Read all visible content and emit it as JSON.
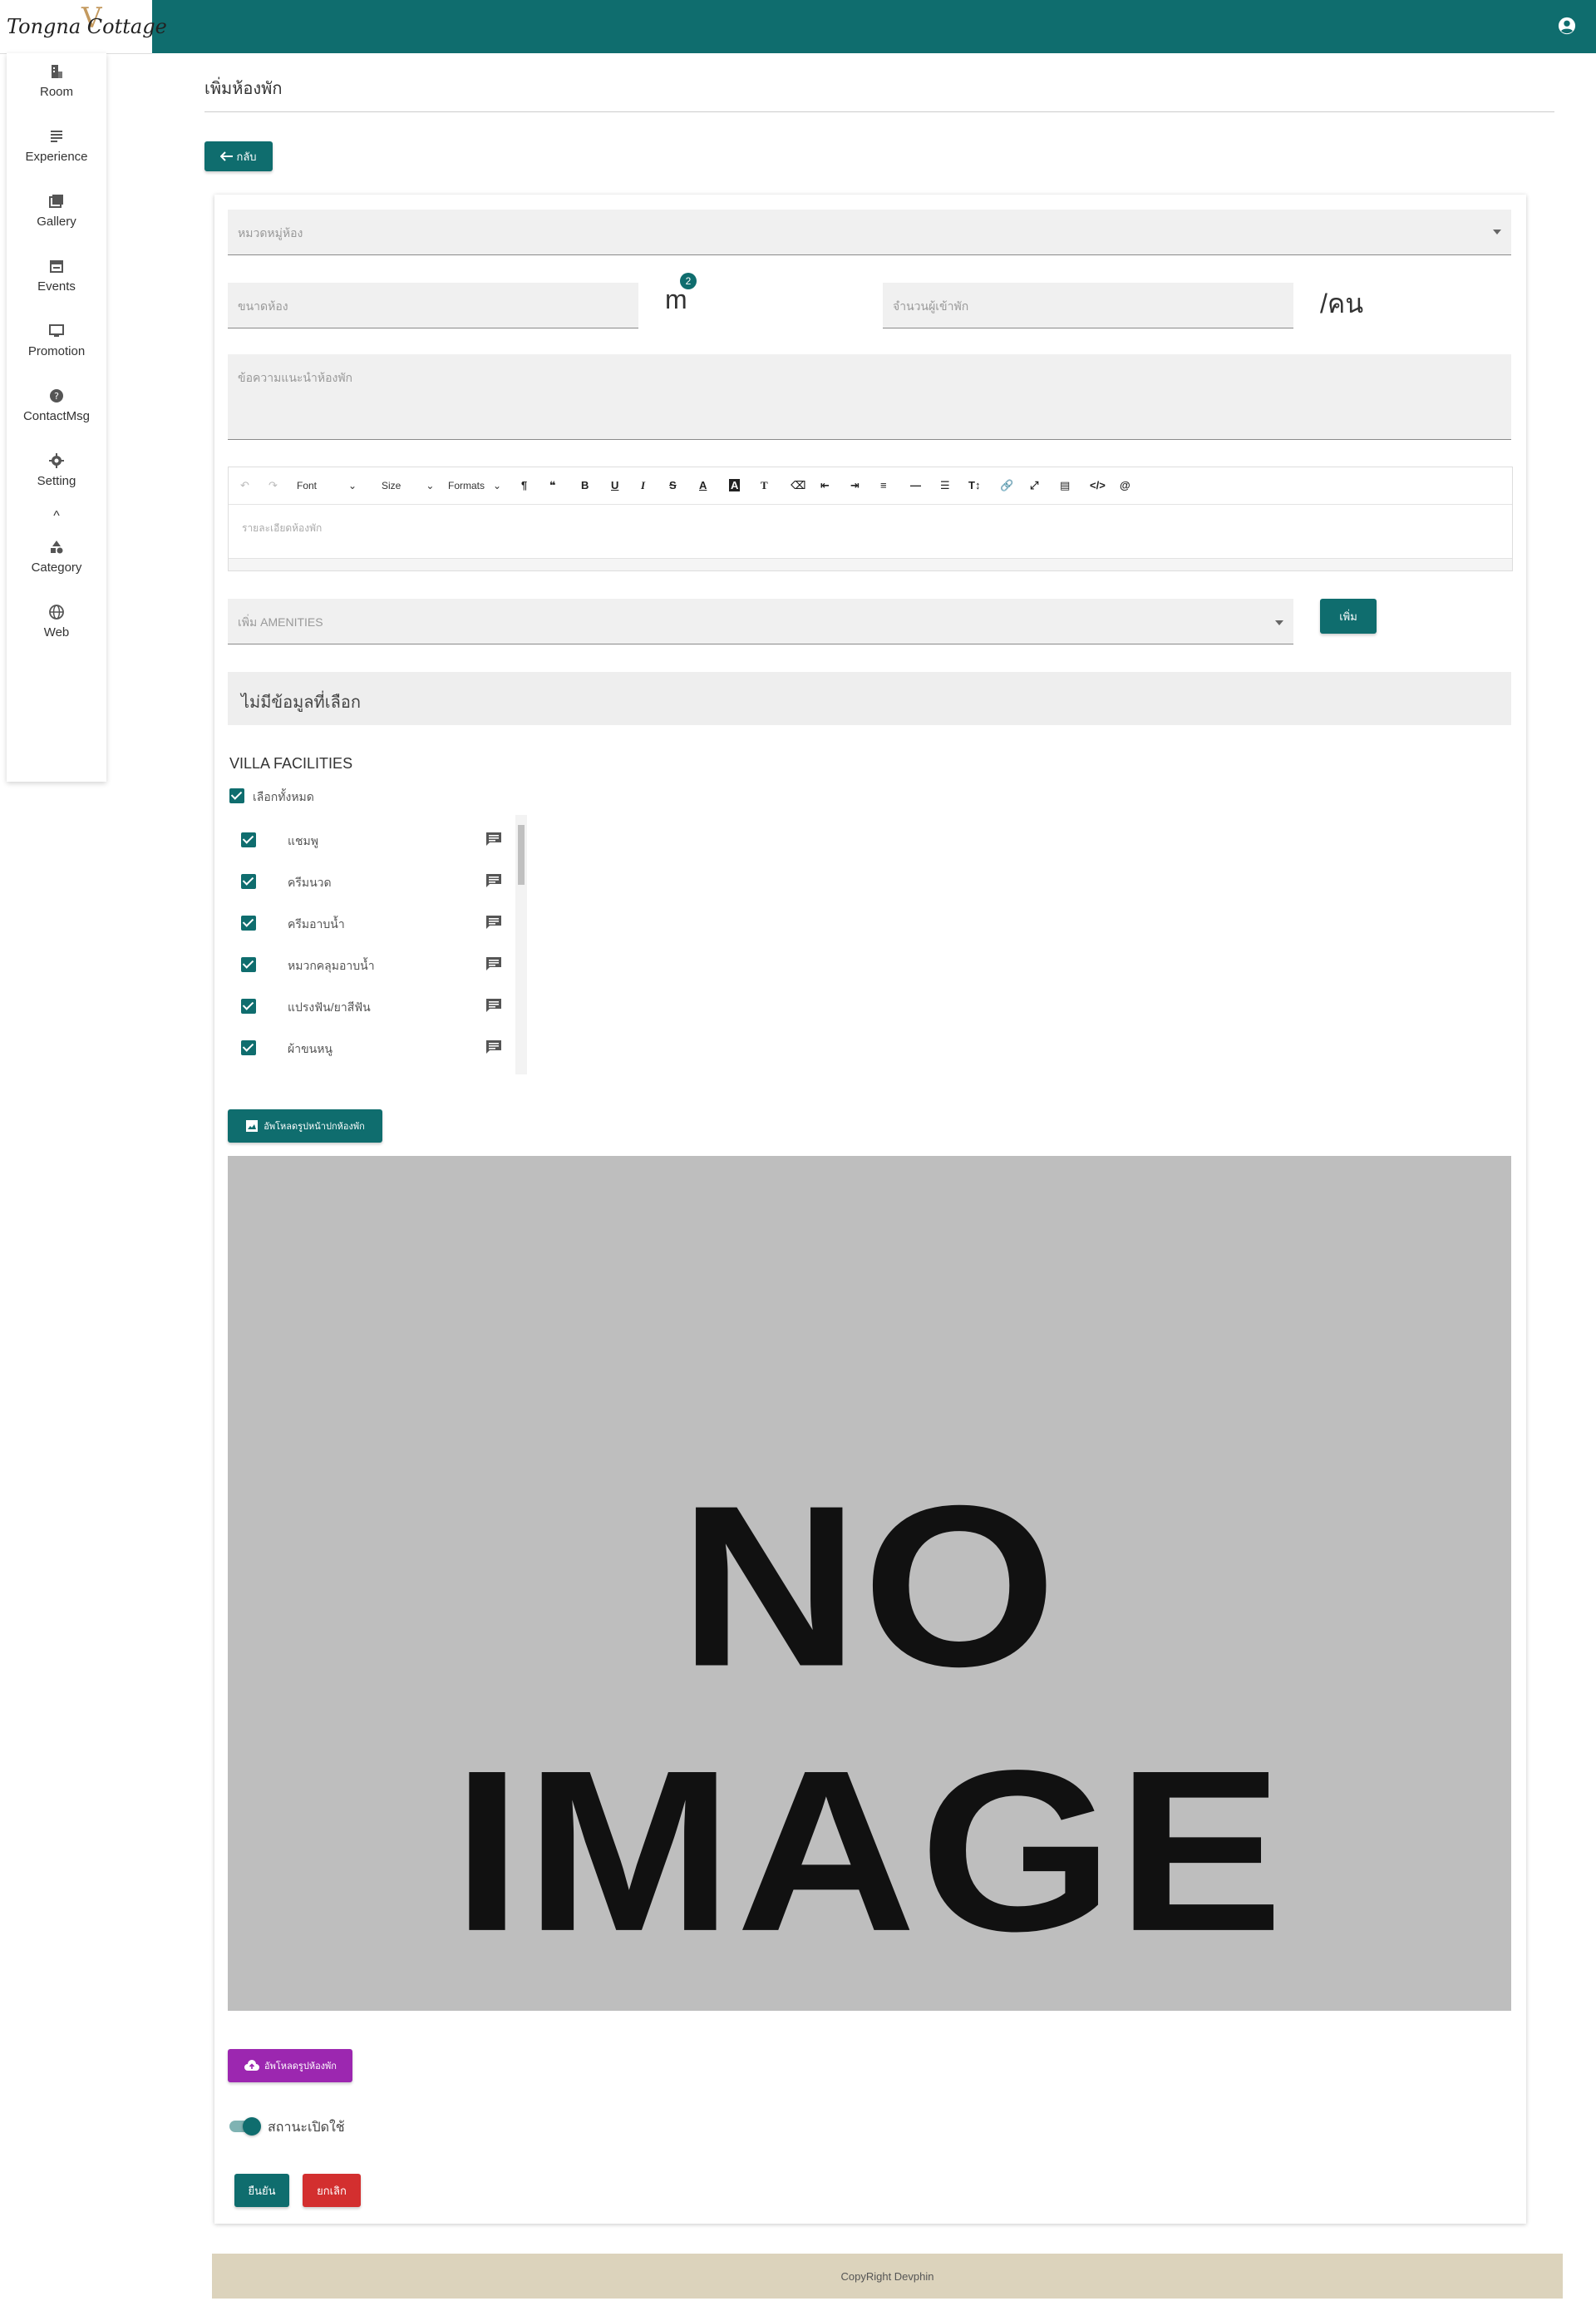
{
  "header": {
    "logo_text": "Tongna Cottage",
    "user_icon": "account-circle-icon"
  },
  "sidebar": {
    "items": [
      {
        "label": "Room",
        "icon": "room-icon"
      },
      {
        "label": "Experience",
        "icon": "list-icon"
      },
      {
        "label": "Gallery",
        "icon": "gallery-icon"
      },
      {
        "label": "Events",
        "icon": "calendar-icon"
      },
      {
        "label": "Promotion",
        "icon": "monitor-icon"
      },
      {
        "label": "ContactMsg",
        "icon": "help-icon"
      },
      {
        "label": "Setting",
        "icon": "gear-icon"
      },
      {
        "label": "Category",
        "icon": "shapes-icon"
      },
      {
        "label": "Web",
        "icon": "globe-icon"
      }
    ]
  },
  "page": {
    "title": "เพิ่มห้องพัก",
    "back_label": "กลับ"
  },
  "form": {
    "category_placeholder": "หมวดหมู่ห้อง",
    "size_placeholder": "ขนาดห้อง",
    "size_unit": "m",
    "size_unit_sup": "2",
    "guests_placeholder": "จำนวนผู้เข้าพัก",
    "guests_unit": "/คน",
    "intro_placeholder": "ข้อความแนะนำห้องพัก",
    "editor": {
      "font_label": "Font",
      "size_label": "Size",
      "formats_label": "Formats",
      "placeholder": "รายละเอียดห้องพัก"
    },
    "amenities_placeholder": "เพิ่ม AMENITIES",
    "add_label": "เพิ่ม",
    "empty_selection": "ไม่มีข้อมูลที่เลือก",
    "facilities_title": "VILLA FACILITIES",
    "select_all_label": "เลือกทั้งหมด",
    "facilities": [
      {
        "label": "แชมพู",
        "checked": true
      },
      {
        "label": "ครีมนวด",
        "checked": true
      },
      {
        "label": "ครีมอาบน้ำ",
        "checked": true
      },
      {
        "label": "หมวกคลุมอาบน้ำ",
        "checked": true
      },
      {
        "label": "แปรงฟัน/ยาสีฟัน",
        "checked": true
      },
      {
        "label": "ผ้าขนหนู",
        "checked": true
      }
    ],
    "upload_cover_label": "อัพโหลดรูปหน้าปกห้องพัก",
    "no_image_text": "NO IMAGE",
    "upload_room_label": "อัพโหลดรูปห้องพัก",
    "status_label": "สถานะเปิดใช้",
    "status_enabled": true,
    "confirm_label": "ยืนยัน",
    "cancel_label": "ยกเลิก"
  },
  "footer": {
    "copyright": "CopyRight Devphin"
  },
  "colors": {
    "primary": "#0f6d6e",
    "purple": "#9c27b0",
    "danger": "#d32f2f",
    "footer_bg": "#dcd3bc"
  }
}
